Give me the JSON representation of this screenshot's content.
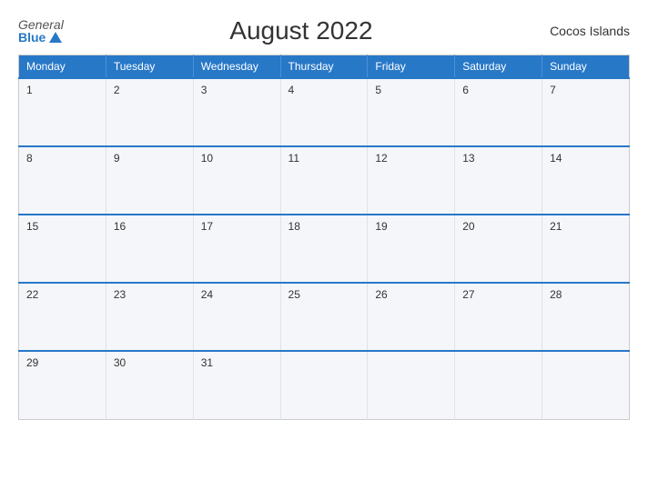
{
  "header": {
    "logo_general": "General",
    "logo_blue": "Blue",
    "title": "August 2022",
    "region": "Cocos Islands"
  },
  "days": [
    "Monday",
    "Tuesday",
    "Wednesday",
    "Thursday",
    "Friday",
    "Saturday",
    "Sunday"
  ],
  "weeks": [
    [
      "1",
      "2",
      "3",
      "4",
      "5",
      "6",
      "7"
    ],
    [
      "8",
      "9",
      "10",
      "11",
      "12",
      "13",
      "14"
    ],
    [
      "15",
      "16",
      "17",
      "18",
      "19",
      "20",
      "21"
    ],
    [
      "22",
      "23",
      "24",
      "25",
      "26",
      "27",
      "28"
    ],
    [
      "29",
      "30",
      "31",
      "",
      "",
      "",
      ""
    ]
  ]
}
